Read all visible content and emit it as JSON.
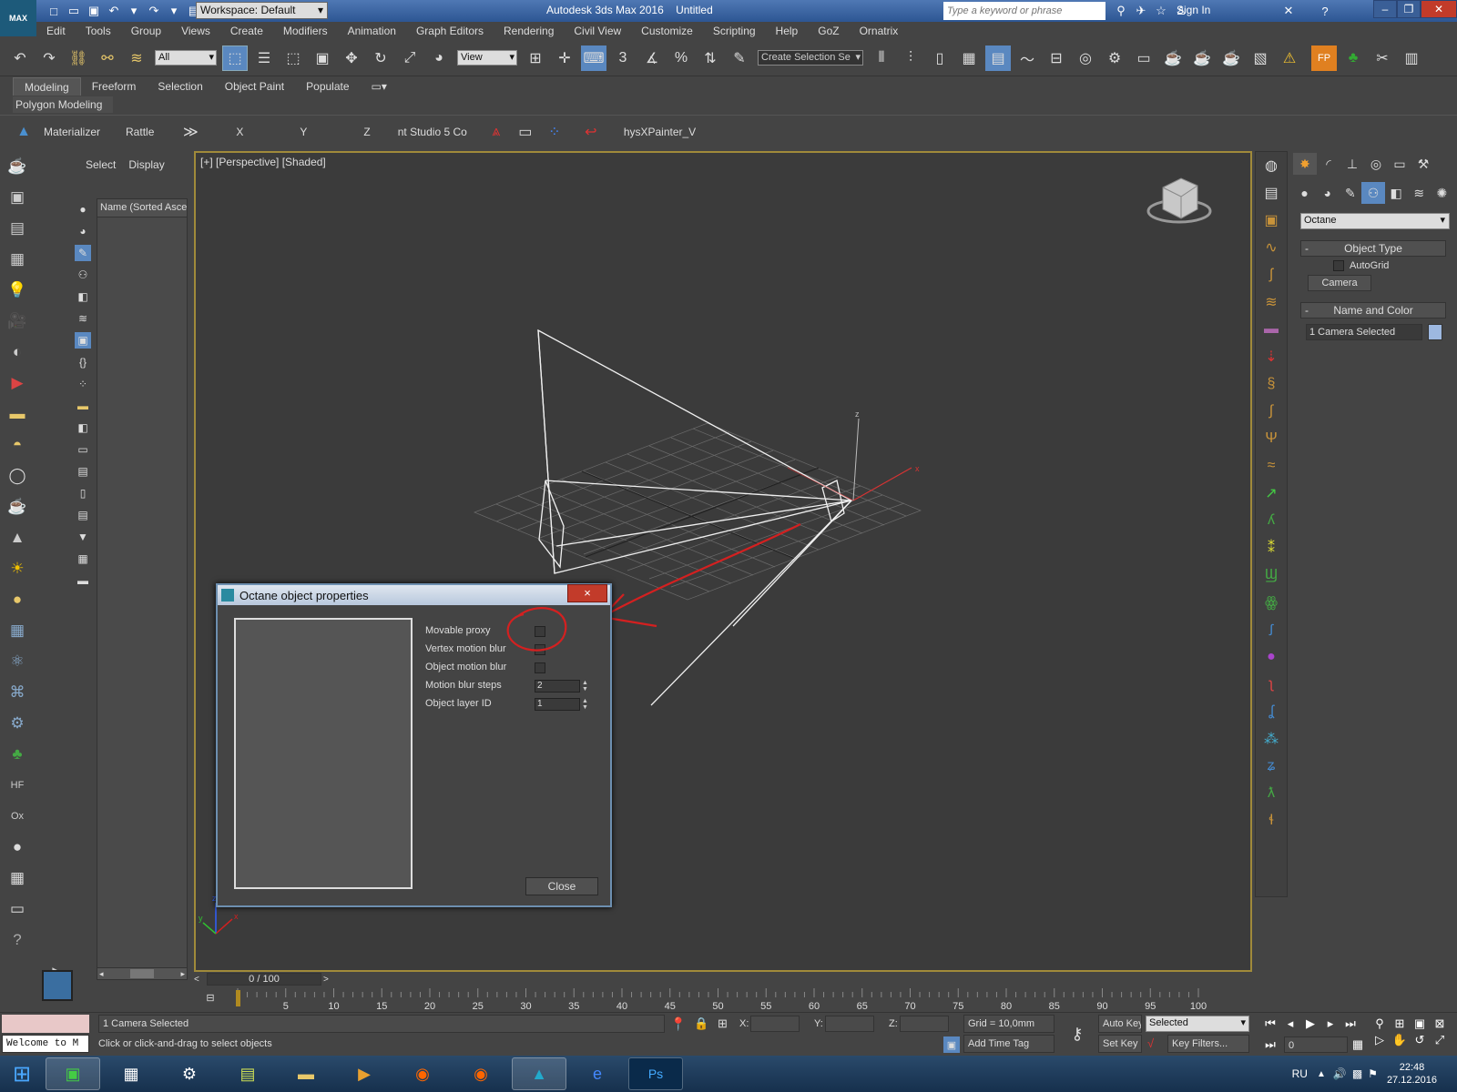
{
  "title_bar": {
    "logo_text": "MAX",
    "workspace": "Workspace: Default",
    "app_title": "Autodesk 3ds Max 2016",
    "doc_title": "Untitled",
    "search_placeholder": "Type a keyword or phrase",
    "sign_in": "Sign In"
  },
  "menu": [
    "Edit",
    "Tools",
    "Group",
    "Views",
    "Create",
    "Modifiers",
    "Animation",
    "Graph Editors",
    "Rendering",
    "Civil View",
    "Customize",
    "Scripting",
    "Help",
    "GoZ",
    "Ornatrix"
  ],
  "main_toolbar": {
    "selection_filter": "All",
    "ref_coord": "View",
    "selection_set": "Create Selection Se",
    "snap_angle": "3",
    "percent_snap": "%"
  },
  "ribbon": {
    "tabs": [
      "Modeling",
      "Freeform",
      "Selection",
      "Object Paint",
      "Populate"
    ],
    "active_tab": "Modeling",
    "panel_label": "Polygon Modeling"
  },
  "toolbar2": {
    "materializer": "Materializer",
    "rattle": "Rattle",
    "x": "X",
    "y": "Y",
    "z": "Z",
    "studio": "nt Studio 5 Co",
    "physx": "hysXPainter_V"
  },
  "scene_explorer": {
    "tab_select": "Select",
    "tab_display": "Display",
    "column_header": "Name (Sorted Ascer"
  },
  "viewport": {
    "label": "[+] [Perspective] [Shaded]",
    "axis_x": "x",
    "axis_y": "y",
    "axis_z": "z"
  },
  "command_panel": {
    "category": "Octane",
    "object_type_header": "Object Type",
    "autogrid": "AutoGrid",
    "camera_button": "Camera",
    "name_color_header": "Name and Color",
    "name_value": "1 Camera Selected",
    "swatch_color": "#9db8e0"
  },
  "dialog": {
    "title": "Octane object properties",
    "close_x": "×",
    "props": {
      "movable_proxy": "Movable proxy",
      "vertex_motion_blur": "Vertex motion blur",
      "object_motion_blur": "Object motion blur",
      "motion_blur_steps": "Motion blur steps",
      "object_layer_id": "Object layer ID"
    },
    "motion_blur_steps_value": "2",
    "object_layer_id_value": "1",
    "close_button": "Close"
  },
  "timeline": {
    "frame_display": "0 / 100",
    "ticks": [
      "5",
      "10",
      "15",
      "20",
      "25",
      "30",
      "35",
      "40",
      "45",
      "50",
      "55",
      "60",
      "65",
      "70",
      "75",
      "80",
      "85",
      "90",
      "95",
      "100"
    ]
  },
  "status": {
    "maxscript": "Welcome to M",
    "selection_info": "1 Camera Selected",
    "prompt": "Click or click-and-drag to select objects",
    "x_label": "X:",
    "y_label": "Y:",
    "z_label": "Z:",
    "grid": "Grid = 10,0mm",
    "add_time_tag": "Add Time Tag",
    "auto_key": "Auto Key",
    "set_key": "Set Key",
    "key_mode": "Selected",
    "key_filters": "Key Filters...",
    "current_frame": "0"
  },
  "taskbar": {
    "lang": "RU",
    "time": "22:48",
    "date": "27.12.2016"
  },
  "colors": {
    "accent": "#4f78b4",
    "viewport_border": "#a08a3a",
    "annotation": "#d42020"
  }
}
